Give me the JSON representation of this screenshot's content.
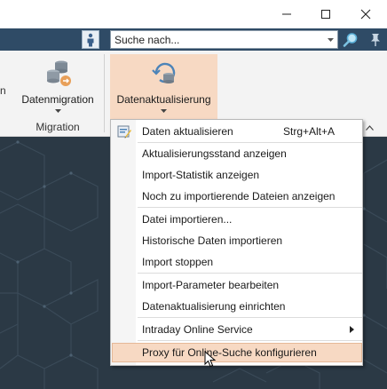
{
  "window": {
    "minimize_icon": "minimize-icon",
    "maximize_icon": "maximize-icon",
    "close_icon": "close-icon"
  },
  "searchbar": {
    "placeholder": "Suche nach...",
    "value": ""
  },
  "ribbon": {
    "left_cut_label": "n",
    "buttons": [
      {
        "label": "Datenmigration"
      },
      {
        "label": "Datenaktualisierung"
      }
    ],
    "group_label": "Migration"
  },
  "menu": {
    "items": [
      {
        "label": "Daten aktualisieren",
        "shortcut": "Strg+Alt+A",
        "icon": "refresh-data-icon"
      },
      {
        "label": "Aktualisierungsstand anzeigen"
      },
      {
        "label": "Import-Statistik anzeigen"
      },
      {
        "label": "Noch zu importierende Dateien anzeigen"
      },
      {
        "label": "Datei importieren..."
      },
      {
        "label": "Historische Daten importieren"
      },
      {
        "label": "Import stoppen"
      },
      {
        "label": "Import-Parameter bearbeiten"
      },
      {
        "label": "Datenaktualisierung einrichten"
      },
      {
        "label": "Intraday Online Service",
        "submenu": true
      },
      {
        "label": "Proxy für Online-Suche konfigurieren",
        "highlighted": true
      }
    ]
  },
  "colors": {
    "accent_highlight": "#f7d9c3",
    "toolbar_bg": "#2f4b66",
    "canvas_bg": "#2b3945"
  }
}
